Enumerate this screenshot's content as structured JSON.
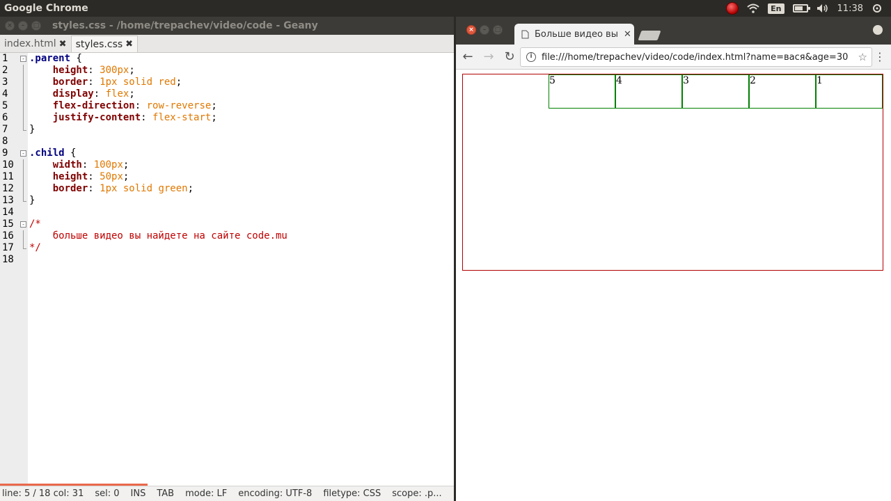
{
  "system_bar": {
    "app_title": "Google Chrome",
    "language": "En",
    "clock": "11:38",
    "battery_level": 0.7
  },
  "geany": {
    "window_title": "styles.css - /home/trepachev/video/code - Geany",
    "tabs": [
      {
        "label": "index.html",
        "active": false
      },
      {
        "label": "styles.css",
        "active": true
      }
    ],
    "line_numbers": [
      "1",
      "2",
      "3",
      "4",
      "5",
      "6",
      "7",
      "8",
      "9",
      "10",
      "11",
      "12",
      "13",
      "14",
      "15",
      "16",
      "17",
      "18"
    ],
    "code": {
      "l1_sel": ".parent",
      "l1_brace": " {",
      "l2_prop": "height",
      "l2_val": "300px",
      "l3_prop": "border",
      "l3_val": "1px solid red",
      "l4_prop": "display",
      "l4_val": "flex",
      "l5_prop": "flex-direction",
      "l5_val": "row-reverse",
      "l6_prop": "justify-content",
      "l6_val": "flex-start",
      "l7": "}",
      "l9_sel": ".child",
      "l9_brace": " {",
      "l10_prop": "width",
      "l10_val": "100px",
      "l11_prop": "height",
      "l11_val": "50px",
      "l12_prop": "border",
      "l12_val": "1px solid green",
      "l13": "}",
      "l15": "/*",
      "l16": "    больше видео вы найдете на сайте code.mu",
      "l17": "*/"
    },
    "status": {
      "line": "line: 5 / 18",
      "col": "col: 31",
      "sel": "sel: 0",
      "ins": "INS",
      "tab": "TAB",
      "mode": "mode: LF",
      "encoding": "encoding: UTF-8",
      "filetype": "filetype: CSS",
      "scope": "scope: .p..."
    }
  },
  "chrome": {
    "tab_title": "Больше видео вы н",
    "url": "file:///home/trepachev/video/code/index.html?name=вася&age=30",
    "children": [
      "1",
      "2",
      "3",
      "4",
      "5"
    ]
  }
}
